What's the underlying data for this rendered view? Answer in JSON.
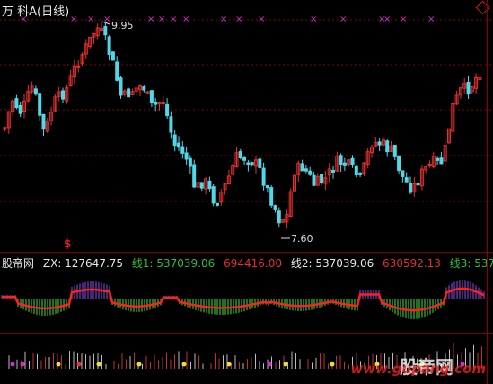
{
  "title": "万  科A(日线)",
  "price_labels": {
    "high": "9.95",
    "low": "7.60"
  },
  "signal_mark": "$",
  "indicator": {
    "name": "股帝网",
    "zx_label": "ZX: 127647.75",
    "line1_label": "线1: 537039.06",
    "value_a": "694416.00",
    "line2_label": "线2: 537039.06",
    "value_b": "630592.13",
    "line3_label": "线3: 537039"
  },
  "watermark": {
    "text": "股帝网",
    "url": "www.gupang.com"
  },
  "colors": {
    "up": "#e83030",
    "down": "#4fd8e8",
    "magenta": "#d030d0",
    "green": "#30c030",
    "red_line": "#ff2020",
    "yellow": "#e8e040",
    "purple": "#7a3cc8"
  }
}
